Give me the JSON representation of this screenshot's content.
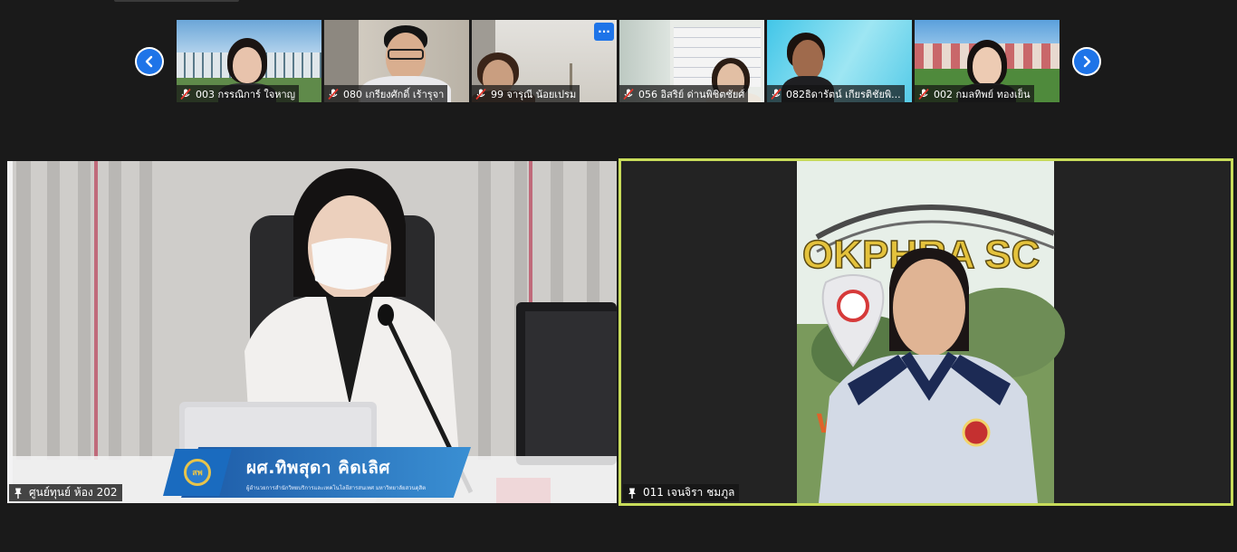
{
  "participants_strip": {
    "prev_label": "‹",
    "next_label": "›",
    "more_label": "···",
    "thumbnails": [
      {
        "name": "003 กรรณิการ์ ใจหาญ",
        "muted": true
      },
      {
        "name": "080 เกรียงศักดิ์ เร้ารุจา",
        "muted": true
      },
      {
        "name": "99 จารุณี  น้อยเปรม",
        "muted": true
      },
      {
        "name": "056 อิสริย์ ด่านพิชิตชัยศ์",
        "muted": true
      },
      {
        "name": "082ธิดารัตน์ เกียรติชัยพิ...",
        "muted": true
      },
      {
        "name": "002 กมลทิพย์  ทองเย็น",
        "muted": true
      }
    ]
  },
  "main_tile": {
    "name": "ศูนย์ทุนย์ ห้อง 202",
    "caption": {
      "logo_text": "สพ",
      "title": "ผศ.ทิพสุดา คิดเลิศ",
      "subtitle": "ผู้อำนวยการสำนักวิทยบริการและเทคโนโลยีสารสนเทศ มหาวิทยาลัยสวนดุสิต"
    }
  },
  "speaker_tile": {
    "name": "011 เจนจิรา ชมภูล",
    "sign_text": "OKPHRA SC",
    "sign_text_bottom": "w            ิe"
  },
  "colors": {
    "accent": "#1e74e8",
    "active_speaker_border": "#c8dc5a",
    "muted_mic": "#e0352b",
    "background": "#1a1a1a"
  }
}
